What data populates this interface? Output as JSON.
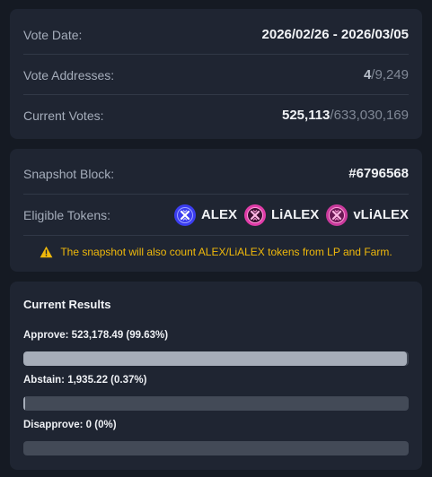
{
  "vote_info": {
    "date_label": "Vote Date:",
    "date_value": "2026/02/26 - 2026/03/05",
    "addresses_label": "Vote Addresses:",
    "addresses_count": "4",
    "addresses_total": "/9,249",
    "votes_label": "Current Votes:",
    "votes_count": "525,113",
    "votes_total": "/633,030,169"
  },
  "snapshot": {
    "block_label": "Snapshot Block:",
    "block_value": "#6796568",
    "tokens_label": "Eligible Tokens:",
    "tokens": [
      {
        "name": "ALEX",
        "icon": "alex-token-icon"
      },
      {
        "name": "LiALEX",
        "icon": "lialex-token-icon"
      },
      {
        "name": "vLiALEX",
        "icon": "vlialex-token-icon"
      }
    ],
    "warning": "The snapshot will also count ALEX/LiALEX tokens from LP and Farm."
  },
  "results": {
    "title": "Current Results",
    "items": [
      {
        "label": "Approve: 523,178.49 (99.63%)",
        "fraction": 0.9963
      },
      {
        "label": "Abstain: 1,935.22 (0.37%)",
        "fraction": 0.0037
      },
      {
        "label": "Disapprove: 0 (0%)",
        "fraction": 0
      }
    ]
  },
  "colors": {
    "background": "#151a23",
    "card": "#1f2532",
    "warning": "#f0b90b",
    "bar_fill": "#a6adb9",
    "bar_track": "#434a57",
    "alex_blue": "#3b3df0",
    "lialex_pink": "#e03ca8"
  }
}
